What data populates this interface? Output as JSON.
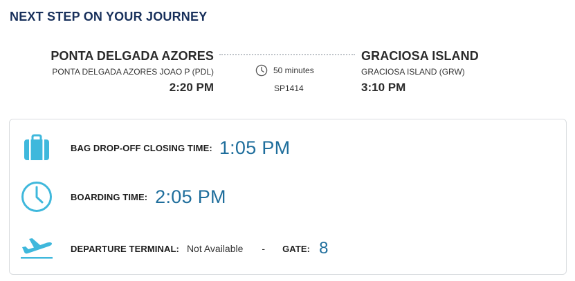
{
  "heading": "NEXT STEP ON YOUR JOURNEY",
  "origin": {
    "city": "PONTA DELGADA AZORES",
    "airport": "PONTA DELGADA AZORES JOAO P (PDL)",
    "time": "2:20 PM"
  },
  "destination": {
    "city": "GRACIOSA ISLAND",
    "airport": "GRACIOSA ISLAND (GRW)",
    "time": "3:10 PM"
  },
  "flight": {
    "duration": "50 minutes",
    "number": "SP1414"
  },
  "details": {
    "bag_dropoff": {
      "label": "BAG DROP-OFF CLOSING TIME:",
      "value": "1:05 PM",
      "icon": "suitcase-icon"
    },
    "boarding": {
      "label": "BOARDING TIME:",
      "value": "2:05 PM",
      "icon": "clock-icon"
    },
    "departure": {
      "label": "DEPARTURE TERMINAL:",
      "value": "Not Available",
      "separator": "-",
      "gate_label": "GATE:",
      "gate_value": "8",
      "icon": "plane-takeoff-icon"
    }
  },
  "colors": {
    "heading": "#18305b",
    "accent_value": "#1f6e9c",
    "icon": "#3fb8dc",
    "card_border": "#d9dcdf",
    "route_dots": "#bfc4c9"
  }
}
